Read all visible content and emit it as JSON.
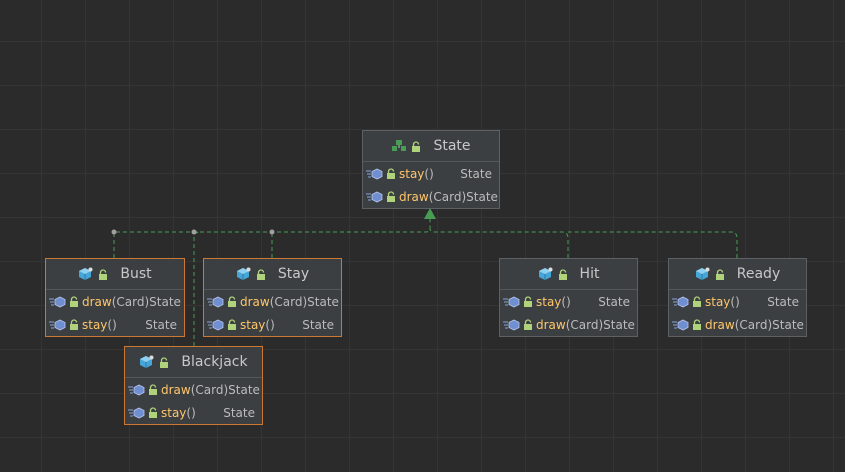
{
  "diagram": {
    "interface": {
      "id": "state",
      "name": "State",
      "icon": "interface-icon",
      "methods": [
        {
          "name": "stay",
          "params": "()",
          "type": "State"
        },
        {
          "name": "draw",
          "params": "(Card)",
          "type": "State"
        }
      ]
    },
    "classes": [
      {
        "id": "bust",
        "name": "Bust",
        "icon": "class-icon",
        "methods": [
          {
            "name": "draw",
            "params": "(Card)",
            "type": "State"
          },
          {
            "name": "stay",
            "params": "()",
            "type": "State"
          }
        ]
      },
      {
        "id": "stay",
        "name": "Stay",
        "icon": "class-icon",
        "methods": [
          {
            "name": "draw",
            "params": "(Card)",
            "type": "State"
          },
          {
            "name": "stay",
            "params": "()",
            "type": "State"
          }
        ]
      },
      {
        "id": "blackjack",
        "name": "Blackjack",
        "icon": "class-icon",
        "methods": [
          {
            "name": "draw",
            "params": "(Card)",
            "type": "State"
          },
          {
            "name": "stay",
            "params": "()",
            "type": "State"
          }
        ]
      },
      {
        "id": "hit",
        "name": "Hit",
        "icon": "class-icon",
        "methods": [
          {
            "name": "stay",
            "params": "()",
            "type": "State"
          },
          {
            "name": "draw",
            "params": "(Card)",
            "type": "State"
          }
        ]
      },
      {
        "id": "ready",
        "name": "Ready",
        "icon": "class-icon",
        "methods": [
          {
            "name": "stay",
            "params": "()",
            "type": "State"
          },
          {
            "name": "draw",
            "params": "(Card)",
            "type": "State"
          }
        ]
      }
    ],
    "relations": [
      {
        "from": "bust",
        "to": "state",
        "kind": "implements"
      },
      {
        "from": "stay",
        "to": "state",
        "kind": "implements"
      },
      {
        "from": "blackjack",
        "to": "state",
        "kind": "implements"
      },
      {
        "from": "hit",
        "to": "state",
        "kind": "implements"
      },
      {
        "from": "ready",
        "to": "state",
        "kind": "implements"
      }
    ],
    "colors": {
      "background": "#2b2b2b",
      "node_fill": "#3c3f41",
      "node_border": "#5d6163",
      "selected_border": "#cc7832",
      "method_name": "#ffc66d",
      "edge": "#499c54",
      "text": "#bbbbbb"
    }
  }
}
